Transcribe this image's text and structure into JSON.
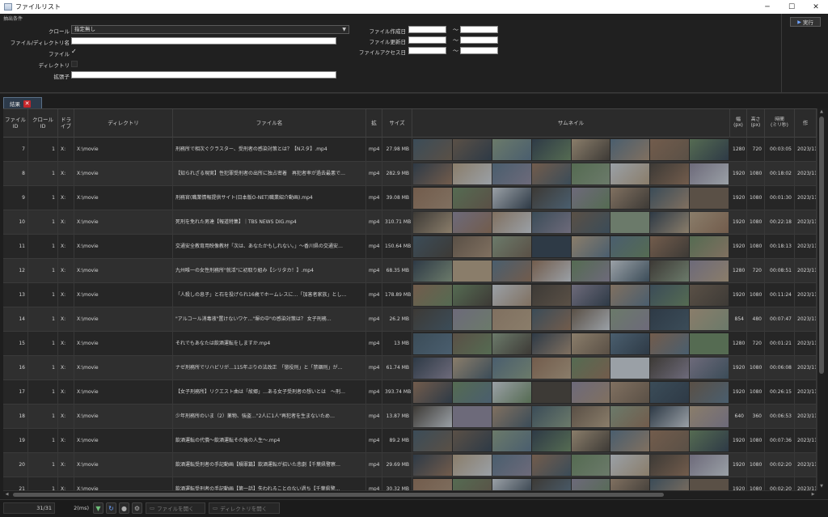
{
  "window": {
    "title": "ファイルリスト",
    "controls": [
      "─",
      "☐",
      "✕"
    ]
  },
  "criteria": {
    "section_title": "抽出条件",
    "crawl_label": "クロール",
    "crawl_value": "指定無し",
    "filedir_label": "ファイル/ディレクトリ名",
    "file_label": "ファイル",
    "dir_label": "ディレクトリ",
    "ext_label": "拡張子",
    "created_label": "ファイル作成日",
    "modified_label": "ファイル更新日",
    "accessed_label": "ファイルアクセス日",
    "range_sep": "～",
    "exec_label": "実行"
  },
  "tab": {
    "label": "結果"
  },
  "columns": {
    "file_id": "ファイル\nID",
    "crawl_id": "クロール\nID",
    "drive": "ドラ\nイブ",
    "directory": "ディレクトリ",
    "filename": "ファイル名",
    "ext": "拡",
    "size": "サイズ",
    "thumbnail": "サムネイル",
    "width": "幅\n(px)",
    "height": "高さ\n(px)",
    "duration": "時間\n(ミリ秒)",
    "created": "作"
  },
  "rows": [
    {
      "id": "7",
      "crawl": "1",
      "drive": "X:",
      "dir": "X:\\movie",
      "name": "刑務所で相次ぐクラスター、受刑者の感染対策とは？【Nスタ】.mp4",
      "ext": "mp4",
      "size": "27.98 MB",
      "w": "1280",
      "h": "720",
      "dur": "00:03:05",
      "date": "2023/11"
    },
    {
      "id": "8",
      "crawl": "1",
      "drive": "X:",
      "dir": "X:\\movie",
      "name": "【知られざる現実】性犯罪受刑者の出所に独占密着　再犯者率が過去最悪で…",
      "ext": "mp4",
      "size": "282.9 MB",
      "w": "1920",
      "h": "1080",
      "dur": "00:18:02",
      "date": "2023/11"
    },
    {
      "id": "9",
      "crawl": "1",
      "drive": "X:",
      "dir": "X:\\movie",
      "name": "刑務官(職業情報提供サイト(日本版O-NET)職業紹介動画).mp4",
      "ext": "mp4",
      "size": "39.08 MB",
      "w": "1920",
      "h": "1080",
      "dur": "00:01:30",
      "date": "2023/11"
    },
    {
      "id": "10",
      "crawl": "1",
      "drive": "X:",
      "dir": "X:\\movie",
      "name": "死刑を免れた男達【報道特集】｜TBS NEWS DIG.mp4",
      "ext": "mp4",
      "size": "310.71 MB",
      "w": "1920",
      "h": "1080",
      "dur": "00:22:18",
      "date": "2023/11"
    },
    {
      "id": "11",
      "crawl": "1",
      "drive": "X:",
      "dir": "X:\\movie",
      "name": "交通安全教育用映像教材「次は、あなたかもしれない。」～香川県の交通安…",
      "ext": "mp4",
      "size": "150.64 MB",
      "w": "1920",
      "h": "1080",
      "dur": "00:18:13",
      "date": "2023/11"
    },
    {
      "id": "12",
      "crawl": "1",
      "drive": "X:",
      "dir": "X:\\movie",
      "name": "九州唯一の女性刑務所\"就活\"に初取り組み【シリタカ！】.mp4",
      "ext": "mp4",
      "size": "68.35 MB",
      "w": "1280",
      "h": "720",
      "dur": "00:08:51",
      "date": "2023/11"
    },
    {
      "id": "13",
      "crawl": "1",
      "drive": "X:",
      "dir": "X:\\movie",
      "name": "「人殺しの息子」と石を投げられ16歳でホームレスに…「加害者家族」とし…",
      "ext": "mp4",
      "size": "178.89 MB",
      "w": "1920",
      "h": "1080",
      "dur": "00:11:24",
      "date": "2023/11"
    },
    {
      "id": "14",
      "crawl": "1",
      "drive": "X:",
      "dir": "X:\\movie",
      "name": "\"アルコール消毒液\"置けないワケ…\"塀の中\"の感染対策は？ 女子刑務…",
      "ext": "mp4",
      "size": "26.2 MB",
      "w": "854",
      "h": "480",
      "dur": "00:07:47",
      "date": "2023/11"
    },
    {
      "id": "15",
      "crawl": "1",
      "drive": "X:",
      "dir": "X:\\movie",
      "name": "それでもあなたは飲酒運転をしますか.mp4",
      "ext": "mp4",
      "size": "13 MB",
      "w": "1280",
      "h": "720",
      "dur": "00:01:21",
      "date": "2023/11"
    },
    {
      "id": "16",
      "crawl": "1",
      "drive": "X:",
      "dir": "X:\\movie",
      "name": "ナゼ刑務所でリハビリが…115年ぶりの法改正　「懲役刑」と「禁錮刑」が…",
      "ext": "mp4",
      "size": "61.74 MB",
      "w": "1920",
      "h": "1080",
      "dur": "00:06:08",
      "date": "2023/11"
    },
    {
      "id": "17",
      "crawl": "1",
      "drive": "X:",
      "dir": "X:\\movie",
      "name": "【女子刑務所】リクエスト曲は「故郷」…ある女子受刑者の想いとは　～刑…",
      "ext": "mp4",
      "size": "393.74 MB",
      "w": "1920",
      "h": "1080",
      "dur": "00:26:15",
      "date": "2023/11"
    },
    {
      "id": "18",
      "crawl": "1",
      "drive": "X:",
      "dir": "X:\\movie",
      "name": "少年刑務所のいま（2）薬物、強盗…\"2人に1人\"再犯者を生まないため…",
      "ext": "mp4",
      "size": "13.87 MB",
      "w": "640",
      "h": "360",
      "dur": "00:06:53",
      "date": "2023/11"
    },
    {
      "id": "19",
      "crawl": "1",
      "drive": "X:",
      "dir": "X:\\movie",
      "name": "飲酒運転の代償～飲酒運転その後の人生～.mp4",
      "ext": "mp4",
      "size": "89.2 MB",
      "w": "1920",
      "h": "1080",
      "dur": "00:07:36",
      "date": "2023/11"
    },
    {
      "id": "20",
      "crawl": "1",
      "drive": "X:",
      "dir": "X:\\movie",
      "name": "飲酒運転受刑者の手記動画【贖罪篇】飲酒運転が招いた悲劇【千葉県警察…",
      "ext": "mp4",
      "size": "29.69 MB",
      "w": "1920",
      "h": "1080",
      "dur": "00:02:20",
      "date": "2023/11"
    },
    {
      "id": "21",
      "crawl": "1",
      "drive": "X:",
      "dir": "X:\\movie",
      "name": "飲酒運転受刑者の手記動画【第一話】失われることのない過ち【千葉県警…",
      "ext": "mp4",
      "size": "30.32 MB",
      "w": "1920",
      "h": "1080",
      "dur": "00:02:20",
      "date": "2023/11"
    }
  ],
  "status": {
    "count": "31/31",
    "time": "2(ms)",
    "open_file_label": "ファイルを開く",
    "open_dir_label": "ディレクトリを開く"
  }
}
